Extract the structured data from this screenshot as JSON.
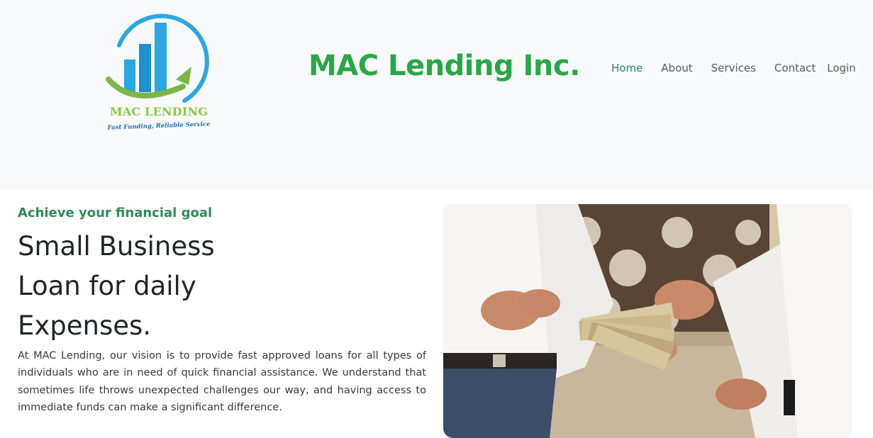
{
  "header": {
    "logo": {
      "name": "MAC LENDING",
      "tagline": "Fast Funding, Reliable Service",
      "colors": {
        "blue": "#2aa7e0",
        "green": "#8cc63f"
      }
    },
    "brand_title": "MAC Lending Inc.",
    "nav": [
      {
        "label": "Home",
        "active": true
      },
      {
        "label": "About",
        "active": false
      },
      {
        "label": "Services",
        "active": false
      },
      {
        "label": "Contact",
        "active": false
      },
      {
        "label": "Login",
        "active": false
      }
    ]
  },
  "hero": {
    "eyebrow": "Achieve your financial goal",
    "headline_lines": [
      "Small Business",
      "Loan for daily",
      "Expenses."
    ],
    "body": "At MAC Lending, our vision is to provide fast approved loans for all types of individuals who are in need of quick financial assistance. We understand that sometimes life throws unexpected challenges our way, and having access to immediate funds can make a significant difference.",
    "image_alt": "photo-hands-exchanging-cash"
  },
  "colors": {
    "brand_green": "#28a745",
    "nav_active": "#1f8a5e",
    "eyebrow_green": "#2e8b57",
    "header_bg": "#f8f9fa"
  }
}
